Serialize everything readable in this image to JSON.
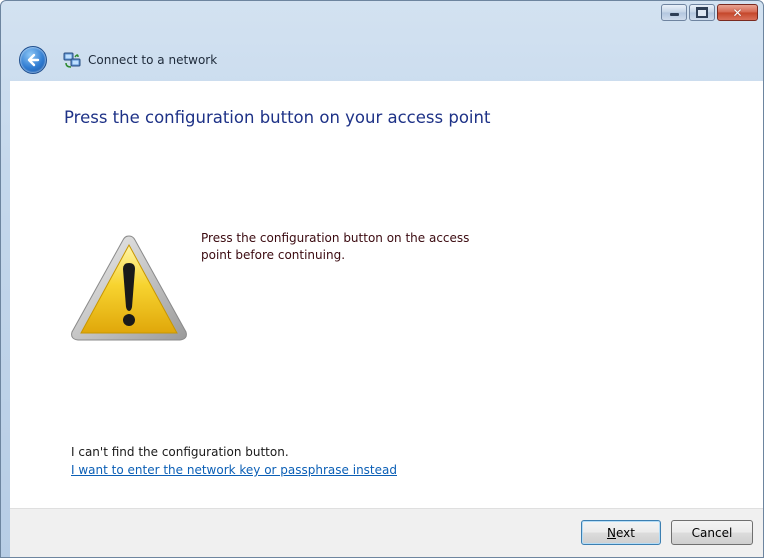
{
  "window": {
    "title": "Connect to a network"
  },
  "caption_buttons": {
    "minimize_icon": "minimize-icon",
    "maximize_icon": "maximize-icon",
    "close_glyph": "✕"
  },
  "nav": {
    "back_icon": "back-arrow-icon",
    "app_icon": "network-connection-icon"
  },
  "main": {
    "heading": "Press the configuration button on your access point",
    "warning_icon": "warning-icon",
    "message": "Press the configuration button on the access point before continuing.",
    "cant_find_text": "I can't find the configuration button.",
    "alternate_link": "I want to enter the network key or passphrase instead"
  },
  "footer": {
    "next_label": "Next",
    "cancel_label": "Cancel"
  },
  "colors": {
    "heading": "#1e3287",
    "message": "#3b0a10",
    "link": "#0b5fb6",
    "warning_fill": "#f3c41b"
  }
}
